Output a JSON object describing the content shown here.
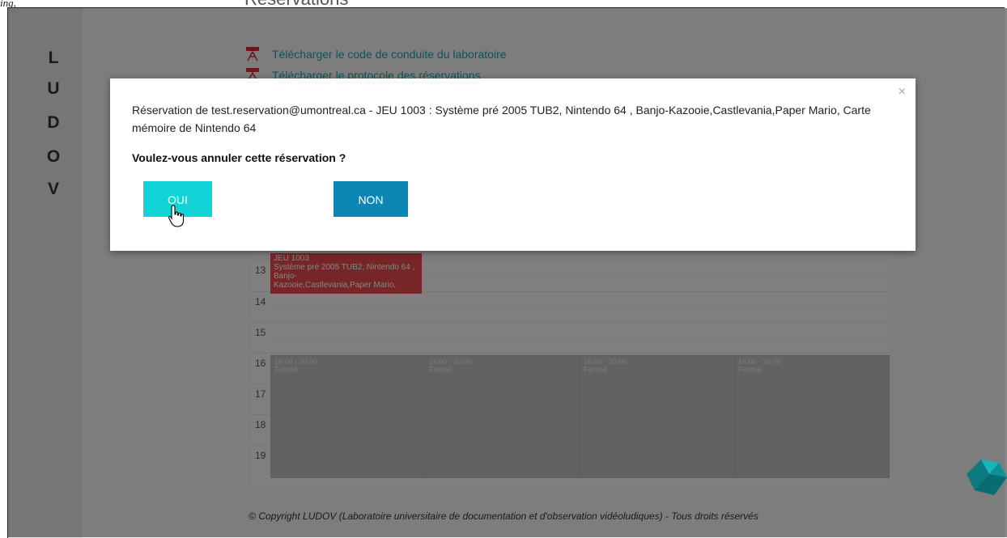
{
  "page": {
    "top_left_text": "ing,",
    "heading": "Réservations"
  },
  "sidebar": {
    "logo_letters": [
      "L",
      "U",
      "D",
      "O",
      "V"
    ]
  },
  "links": [
    {
      "label": "Télécharger le code de conduite du laboratoire",
      "icon": "pdf-icon"
    },
    {
      "label": "Télécharger le protocole des réservations",
      "icon": "pdf-icon"
    }
  ],
  "calendar": {
    "hours": [
      "13",
      "14",
      "15",
      "16",
      "17",
      "18",
      "19"
    ],
    "event": {
      "line1": "JEU 1003",
      "line2": "Système pré 2005 TUB2, Nintendo 64 , Banjo-",
      "line3": "Kazooie,Castlevania,Paper Mario,"
    },
    "closed": [
      {
        "time": "16:00 - 20:00",
        "status": "Fermé"
      },
      {
        "time": "16:00 - 20:00",
        "status": "Fermé"
      },
      {
        "time": "16:00 - 20:00",
        "status": "Fermé"
      },
      {
        "time": "16:00 - 20:00",
        "status": "Fermé"
      }
    ]
  },
  "footer": {
    "text": "© Copyright LUDOV (Laboratoire universitaire de documentation et d'observation vidéoludiques) - Tous droits réservés"
  },
  "modal": {
    "close": "×",
    "message": "Réservation de test.reservation@umontreal.ca - JEU 1003 : Système pré 2005 TUB2, Nintendo 64 , Banjo-Kazooie,Castlevania,Paper Mario, Carte mémoire de Nintendo 64",
    "question": "Voulez-vous annuler cette réservation ?",
    "yes_label": "OUI",
    "no_label": "NON"
  },
  "colors": {
    "accent_yes": "#12d3d6",
    "accent_no": "#0d86b3",
    "event_red": "#e24a4a",
    "link_teal": "#1aa3a0"
  }
}
